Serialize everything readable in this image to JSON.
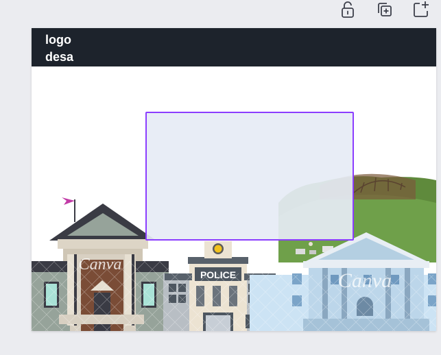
{
  "toolbar": {
    "lock_icon": "unlock-icon",
    "duplicate_icon": "duplicate-icon",
    "add_page_icon": "add-page-icon"
  },
  "canvas": {
    "logo_text": "logo\ndesa",
    "police_sign": "POLICE",
    "watermark": "Canva"
  },
  "colors": {
    "header_bg": "#1d232c",
    "selection_border": "#8b3dff",
    "workspace_bg": "#ebecf0"
  }
}
